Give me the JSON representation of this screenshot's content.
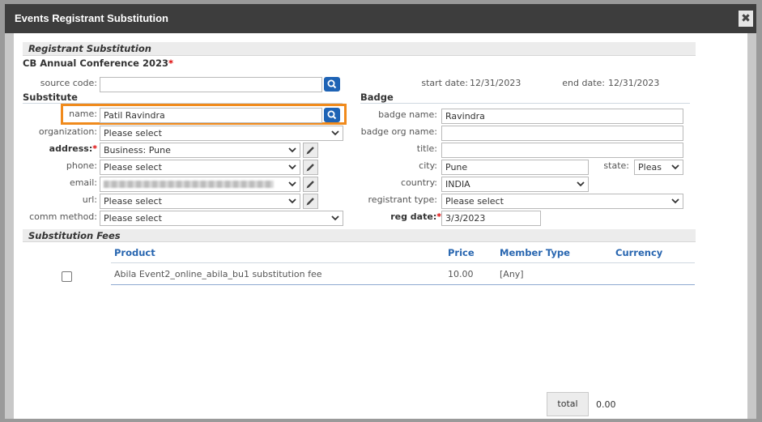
{
  "dialog": {
    "title": "Events Registrant Substitution",
    "close_glyph": "✖"
  },
  "section_registrant": {
    "title": "Registrant Substitution",
    "event_name": "CB Annual Conference 2023",
    "required_mark": "*",
    "source_code_label": "source code:",
    "source_code_value": "",
    "start_date_label": "start date:",
    "start_date_value": "12/31/2023",
    "end_date_label": "end date:",
    "end_date_value": "12/31/2023"
  },
  "substitute": {
    "heading": "Substitute",
    "name_label": "name:",
    "name_value": "Patil Ravindra",
    "organization_label": "organization:",
    "organization_value": "Please select",
    "address_label": "address:",
    "address_value": "Business: Pune",
    "phone_label": "phone:",
    "phone_value": "Please select",
    "email_label": "email:",
    "url_label": "url:",
    "url_value": "Please select",
    "comm_method_label": "comm method:",
    "comm_method_value": "Please select"
  },
  "badge": {
    "heading": "Badge",
    "badge_name_label": "badge name:",
    "badge_name_value": "Ravindra",
    "badge_org_label": "badge org name:",
    "badge_org_value": "",
    "title_label": "title:",
    "title_value": "",
    "city_label": "city:",
    "city_value": "Pune",
    "state_label": "state:",
    "state_value": "Pleas",
    "country_label": "country:",
    "country_value": "INDIA",
    "registrant_type_label": "registrant type:",
    "registrant_type_value": "Please select",
    "reg_date_label": "reg date:",
    "reg_date_value": "3/3/2023"
  },
  "fees": {
    "title": "Substitution Fees",
    "columns": [
      "Product",
      "Price",
      "Member Type",
      "Currency"
    ],
    "rows": [
      {
        "product": "Abila Event2_online_abila_bu1 substitution fee",
        "price": "10.00",
        "member_type": "[Any]",
        "currency": ""
      }
    ],
    "total_label": "total",
    "total_value": "0.00"
  },
  "colors": {
    "accent": "#2866b0",
    "highlight": "#f08a1c",
    "search_button": "#1e63b5",
    "titlebar": "#3d3d3d"
  },
  "icons": [
    "close-icon",
    "search-icon",
    "pencil-icon",
    "chevron-down-icon",
    "checkbox"
  ]
}
